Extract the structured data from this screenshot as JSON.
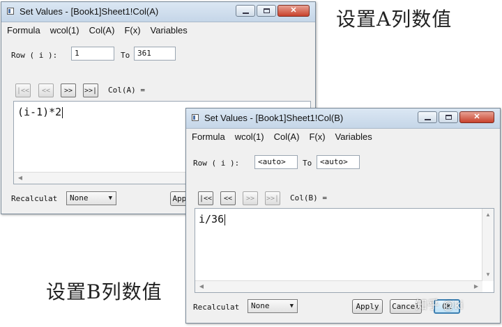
{
  "captions": {
    "a": "设置A列数值",
    "b": "设置B列数值"
  },
  "window_a": {
    "title": "Set Values - [Book1]Sheet1!Col(A)",
    "menu": [
      "Formula",
      "wcol(1)",
      "Col(A)",
      "F(x)",
      "Variables"
    ],
    "row_label": "Row ( i ):",
    "row_from": "1",
    "to_label": "To",
    "row_to": "361",
    "nav": [
      "|<<",
      "<<",
      ">>",
      ">>|"
    ],
    "col_label": "Col(A) =",
    "formula": "(i-1)*2",
    "recalc_label": "Recalculat",
    "recalc_value": "None",
    "apply_label": "Apply"
  },
  "window_b": {
    "title": "Set Values - [Book1]Sheet1!Col(B)",
    "menu": [
      "Formula",
      "wcol(1)",
      "Col(A)",
      "F(x)",
      "Variables"
    ],
    "row_label": "Row ( i ):",
    "row_from": "<auto>",
    "to_label": "To",
    "row_to": "<auto>",
    "nav": [
      "|<<",
      "<<",
      ">>",
      ">>|"
    ],
    "col_label": "Col(B) =",
    "formula": "i/36",
    "recalc_label": "Recalculat",
    "recalc_value": "None",
    "apply_label": "Apply",
    "cancel_label": "Cancel",
    "ok_label": "OK"
  },
  "watermark": "知乎 @ki"
}
